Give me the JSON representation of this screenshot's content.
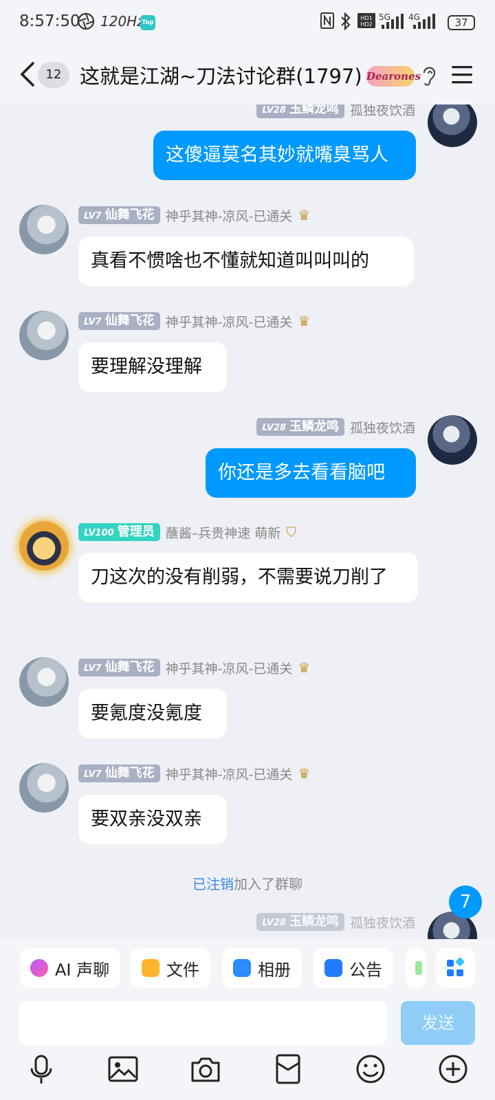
{
  "status_bar": {
    "time": "8:57:50",
    "refresh_rate": "120Hz",
    "tap_badge": "Tap",
    "network_5g": "5G",
    "network_4g": "4G",
    "battery": "37"
  },
  "header": {
    "unread_count": "12",
    "title": "这就是江湖~刀法讨论群(1797)",
    "badge": "Dearones"
  },
  "messages": [
    {
      "level": "LV28",
      "title": "玉鳞龙鸣",
      "nick": "孤独夜饮酒",
      "side": "out",
      "text": "这傻逼莫名其妙就嘴臭骂人"
    },
    {
      "level": "LV7",
      "title": "仙舞飞花",
      "nick": "神乎其神-凉风-已通关",
      "side": "in",
      "text": "真看不惯啥也不懂就知道叫叫叫的"
    },
    {
      "level": "LV7",
      "title": "仙舞飞花",
      "nick": "神乎其神-凉风-已通关",
      "side": "in",
      "text": "要理解没理解"
    },
    {
      "level": "LV28",
      "title": "玉鳞龙鸣",
      "nick": "孤独夜饮酒",
      "side": "out",
      "text": "你还是多去看看脑吧"
    },
    {
      "level": "LV100",
      "title": "管理员",
      "nick": "蘸酱–兵贵神速 萌新",
      "side": "in",
      "text": "刀这次的没有削弱，不需要说刀削了"
    },
    {
      "level": "LV7",
      "title": "仙舞飞花",
      "nick": "神乎其神-凉风-已通关",
      "side": "in",
      "text": "要氪度没氪度"
    },
    {
      "level": "LV7",
      "title": "仙舞飞花",
      "nick": "神乎其神-凉风-已通关",
      "side": "in",
      "text": "要双亲没双亲"
    }
  ],
  "system_notice": {
    "link": "已注销",
    "text": "加入了群聊"
  },
  "new_message_count": "7",
  "toolbar": {
    "ai_voice": "AI 声聊",
    "files": "文件",
    "album": "相册",
    "notice": "公告"
  },
  "input": {
    "value": "",
    "send_label": "发送"
  },
  "colors": {
    "accent": "#0099ff",
    "admin": "#35d3c1",
    "level": "#a9b0c3"
  },
  "bottom_icons": [
    "microphone-icon",
    "image-icon",
    "camera-icon",
    "red-packet-icon",
    "emoji-icon",
    "plus-icon"
  ]
}
